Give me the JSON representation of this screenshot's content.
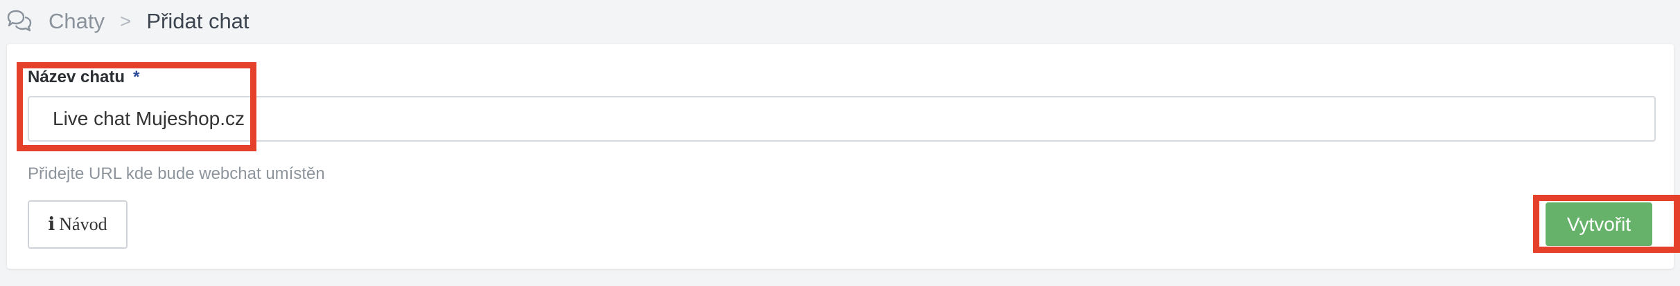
{
  "breadcrumb": {
    "icon": "chat-bubbles-icon",
    "root": "Chaty",
    "separator": ">",
    "current": "Přidat chat"
  },
  "form": {
    "label": "Název chatu",
    "required_marker": "*",
    "input_value": "Live chat Mujeshop.cz",
    "hint": "Přidejte URL kde bude webchat umístěn",
    "guide_button_icon": "info-icon",
    "guide_button_label": "Návod",
    "create_button_label": "Vytvořit"
  },
  "colors": {
    "page_bg": "#f3f4f6",
    "create_button": "#67b26a",
    "required_marker": "#2b4a9a",
    "highlight": "#e5402a"
  }
}
